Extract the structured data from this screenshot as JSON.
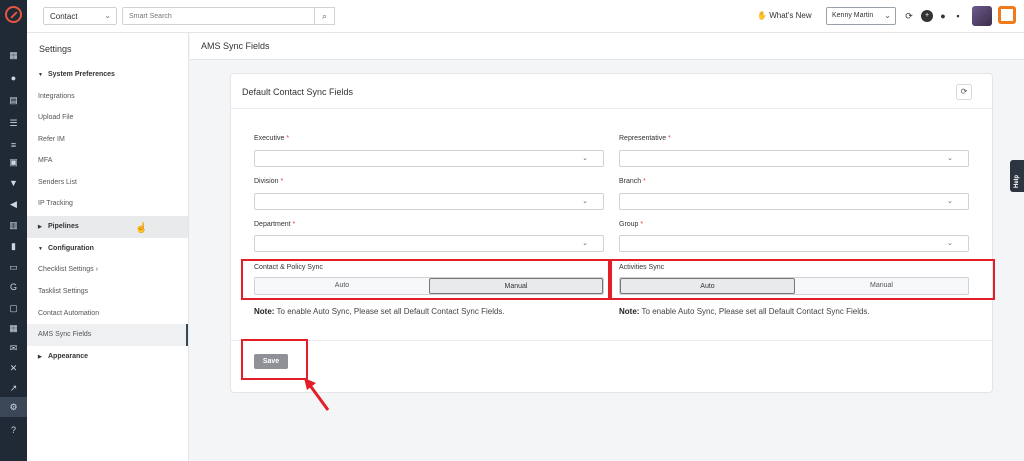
{
  "topbar": {
    "contact_select": "Contact",
    "search_placeholder": "Smart Search",
    "whats_new": "What's New",
    "user_name": "Kenny Martin"
  },
  "sidebar": {
    "title": "Settings",
    "items": [
      {
        "label": "System Preferences",
        "type": "group"
      },
      {
        "label": "Integrations",
        "type": "item"
      },
      {
        "label": "Upload File",
        "type": "item"
      },
      {
        "label": "Refer IM",
        "type": "item"
      },
      {
        "label": "MFA",
        "type": "item"
      },
      {
        "label": "Senders List",
        "type": "item"
      },
      {
        "label": "IP Tracking",
        "type": "item"
      },
      {
        "label": "Pipelines",
        "type": "group"
      },
      {
        "label": "Configuration",
        "type": "group"
      },
      {
        "label": "Checklist Settings",
        "type": "item"
      },
      {
        "label": "Tasklist Settings",
        "type": "item"
      },
      {
        "label": "Contact Automation",
        "type": "item"
      },
      {
        "label": "AMS Sync Fields",
        "type": "item"
      },
      {
        "label": "Appearance",
        "type": "group"
      }
    ]
  },
  "page": {
    "title": "AMS Sync Fields",
    "card_title": "Default Contact Sync Fields"
  },
  "fields": {
    "executive": "Executive",
    "representative": "Representative",
    "division": "Division",
    "branch": "Branch",
    "department": "Department",
    "group": "Group",
    "required_mark": "*"
  },
  "sync": {
    "contact_policy_label": "Contact & Policy Sync",
    "contact_policy_options": [
      "Auto",
      "Manual"
    ],
    "contact_policy_selected": "Manual",
    "activities_label": "Activities Sync",
    "activities_options": [
      "Auto",
      "Manual"
    ],
    "activities_selected": "Auto",
    "note_bold": "Note:",
    "note_text": " To enable Auto Sync, Please set all Default Contact Sync Fields."
  },
  "save_label": "Save",
  "help_label": "Help",
  "colors": {
    "highlight": "#e41e26",
    "rail": "#1f2a36",
    "save_button": "#8e9196"
  }
}
